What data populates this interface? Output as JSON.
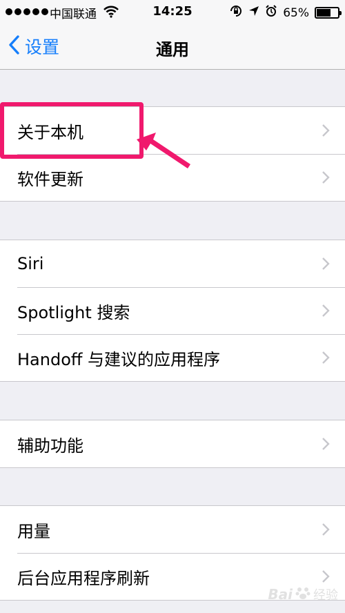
{
  "status_bar": {
    "carrier": "中国联通",
    "time": "14:25",
    "battery_percent": "65%",
    "battery_level": 0.65,
    "icons": [
      "signal-dots-icon",
      "wifi-icon",
      "rotation-lock-icon",
      "location-icon",
      "alarm-icon",
      "battery-icon"
    ]
  },
  "nav": {
    "back_label": "设置",
    "title": "通用"
  },
  "groups": [
    {
      "items": [
        {
          "label": "关于本机"
        },
        {
          "label": "软件更新"
        }
      ]
    },
    {
      "items": [
        {
          "label": "Siri"
        },
        {
          "label": "Spotlight 搜索"
        },
        {
          "label": "Handoff 与建议的应用程序"
        }
      ]
    },
    {
      "items": [
        {
          "label": "辅助功能"
        }
      ]
    },
    {
      "items": [
        {
          "label": "用量"
        },
        {
          "label": "后台应用程序刷新"
        }
      ]
    }
  ],
  "colors": {
    "accent": "#157efb",
    "highlight": "#f0196d",
    "background": "#efeff4"
  },
  "watermark": {
    "brand": "Bai",
    "text": "经验"
  }
}
